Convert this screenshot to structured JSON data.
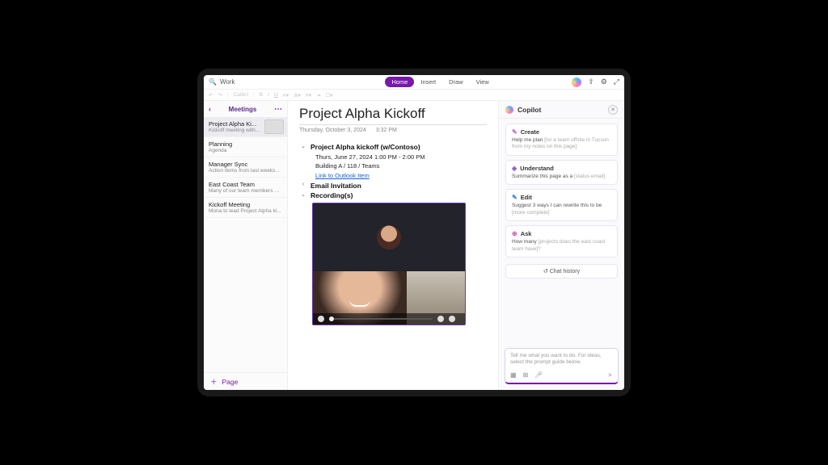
{
  "search": {
    "value": "Work"
  },
  "tabs": {
    "home": "Home",
    "insert": "Insert",
    "draw": "Draw",
    "view": "View"
  },
  "format": {
    "font": "Calibri"
  },
  "sidebar": {
    "section": "Meetings",
    "items": [
      {
        "title": "Project Alpha Ki...",
        "sub": "Kickoff meeting with..."
      },
      {
        "title": "Planning",
        "sub": "Agenda"
      },
      {
        "title": "Manager Sync",
        "sub": "Action items from last weeks..."
      },
      {
        "title": "East Coast Team",
        "sub": "Many of our team members ar..."
      },
      {
        "title": "Kickoff Meeting",
        "sub": "Mona to lead Project Alpha ki..."
      }
    ],
    "addPage": "Page"
  },
  "page": {
    "title": "Project Alpha Kickoff",
    "date": "Thursday, October 3, 2024",
    "time": "3:32 PM",
    "meeting": {
      "heading": "Project Alpha kickoff (w/Contoso)",
      "when": "Thurs, June 27, 2024 1:00 PM - 2:00 PM",
      "where": "Building A / 118 / Teams",
      "link": "Link to Outlook Item",
      "invite": "Email Invitation",
      "recordings": "Recording(s)"
    }
  },
  "copilot": {
    "title": "Copilot",
    "cards": [
      {
        "icon": "✎",
        "iconColor": "#d063c9",
        "title": "Create",
        "body": "Help me plan ",
        "hint": "[for a team offsite in Tucson from my notes on this page]"
      },
      {
        "icon": "◈",
        "iconColor": "#8a5ad0",
        "title": "Understand",
        "body": "Summarize this page as a ",
        "hint": "[status email]"
      },
      {
        "icon": "✎",
        "iconColor": "#3a86d8",
        "title": "Edit",
        "body": "Suggest 3 ways I can rewrite this to be ",
        "hint": "[more complete]"
      },
      {
        "icon": "⊕",
        "iconColor": "#c956a8",
        "title": "Ask",
        "body": "How many ",
        "hint": "[projects does the east coast team have]?"
      }
    ],
    "history": "Chat history",
    "placeholder": "Tell me what you want to do. For ideas, select the prompt guide below."
  }
}
